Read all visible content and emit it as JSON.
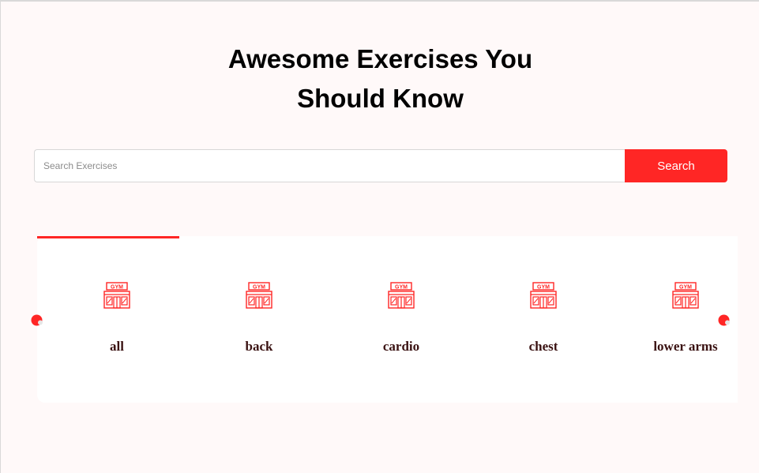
{
  "heading": {
    "line1": "Awesome Exercises You",
    "line2": "Should Know"
  },
  "search": {
    "placeholder": "Search Exercises",
    "value": "",
    "button_label": "Search"
  },
  "categories": [
    {
      "label": "all",
      "icon": "gym-icon",
      "active": true
    },
    {
      "label": "back",
      "icon": "gym-icon",
      "active": false
    },
    {
      "label": "cardio",
      "icon": "gym-icon",
      "active": false
    },
    {
      "label": "chest",
      "icon": "gym-icon",
      "active": false
    },
    {
      "label": "lower arms",
      "icon": "gym-icon",
      "active": false
    }
  ],
  "icon_text": "GYM",
  "nav": {
    "prev_icon": "left-arrow-icon",
    "next_icon": "right-arrow-icon"
  },
  "colors": {
    "accent": "#ff2625",
    "background": "#fff9f9",
    "card": "#ffffff",
    "label": "#3a1212"
  }
}
